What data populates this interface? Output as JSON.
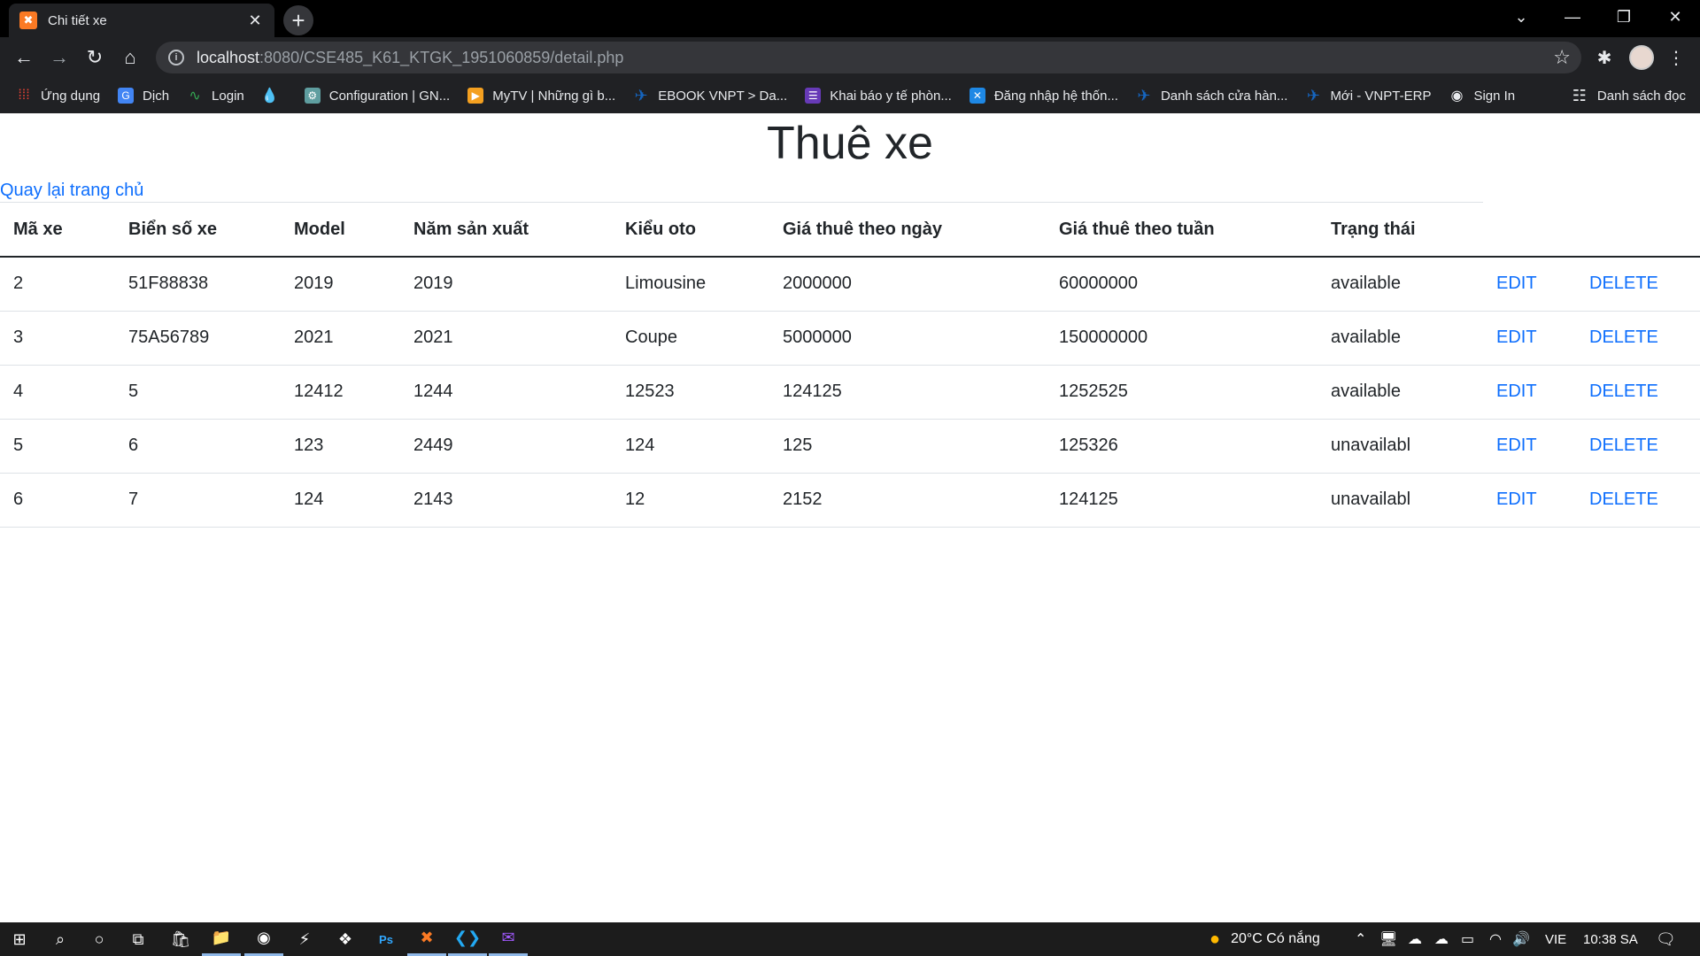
{
  "browser": {
    "tab_title": "Chi tiết xe",
    "url_host": "localhost",
    "url_rest": ":8080/CSE485_K61_KTGK_1951060859/detail.php",
    "bookmarks": [
      {
        "label": "Ứng dụng",
        "icon": "apps-grid-icon",
        "color": "#ea4335"
      },
      {
        "label": "Dịch",
        "icon": "translate-icon",
        "color": "#4285f4"
      },
      {
        "label": "Login",
        "icon": "pulse-icon",
        "color": "#34a853"
      },
      {
        "label": "",
        "icon": "drop-icon",
        "color": "#1a73e8"
      },
      {
        "label": "Configuration | GN...",
        "icon": "config-icon",
        "color": "#5f9ea0"
      },
      {
        "label": "MyTV | Những gì b...",
        "icon": "mytv-icon",
        "color": "#f4a020"
      },
      {
        "label": "EBOOK VNPT > Da...",
        "icon": "vnpt-icon",
        "color": "#1565c0"
      },
      {
        "label": "Khai báo y tế phòn...",
        "icon": "form-icon",
        "color": "#673ab7"
      },
      {
        "label": "Đăng nhập hệ thốn...",
        "icon": "x-logo-icon",
        "color": "#1e88e5"
      },
      {
        "label": "Danh sách cửa hàn...",
        "icon": "vnpt-icon",
        "color": "#1565c0"
      },
      {
        "label": "Mới - VNPT-ERP",
        "icon": "vnpt-icon",
        "color": "#1565c0"
      },
      {
        "label": "Sign In",
        "icon": "globe-icon",
        "color": "#e8eaed"
      }
    ],
    "reading_list": "Danh sách đọc"
  },
  "page": {
    "title": "Thuê xe",
    "home_link": "Quay lại trang chủ",
    "columns": [
      "Mã xe",
      "Biển số xe",
      "Model",
      "Năm sản xuất",
      "Kiểu oto",
      "Giá thuê theo ngày",
      "Giá thuê theo tuần",
      "Trạng thái"
    ],
    "edit_label": "EDIT",
    "delete_label": "DELETE",
    "rows": [
      [
        "2",
        "51F88838",
        "2019",
        "2019",
        "Limousine",
        "2000000",
        "60000000",
        "available"
      ],
      [
        "3",
        "75A56789",
        "2021",
        "2021",
        "Coupe",
        "5000000",
        "150000000",
        "available"
      ],
      [
        "4",
        "5",
        "12412",
        "1244",
        "12523",
        "124125",
        "1252525",
        "available"
      ],
      [
        "5",
        "6",
        "123",
        "2449",
        "124",
        "125",
        "125326",
        "unavailabl"
      ],
      [
        "6",
        "7",
        "124",
        "2143",
        "12",
        "2152",
        "124125",
        "unavailabl"
      ]
    ]
  },
  "taskbar": {
    "weather": "20°C  Có nắng",
    "lang": "VIE",
    "time": "10:38 SA"
  }
}
